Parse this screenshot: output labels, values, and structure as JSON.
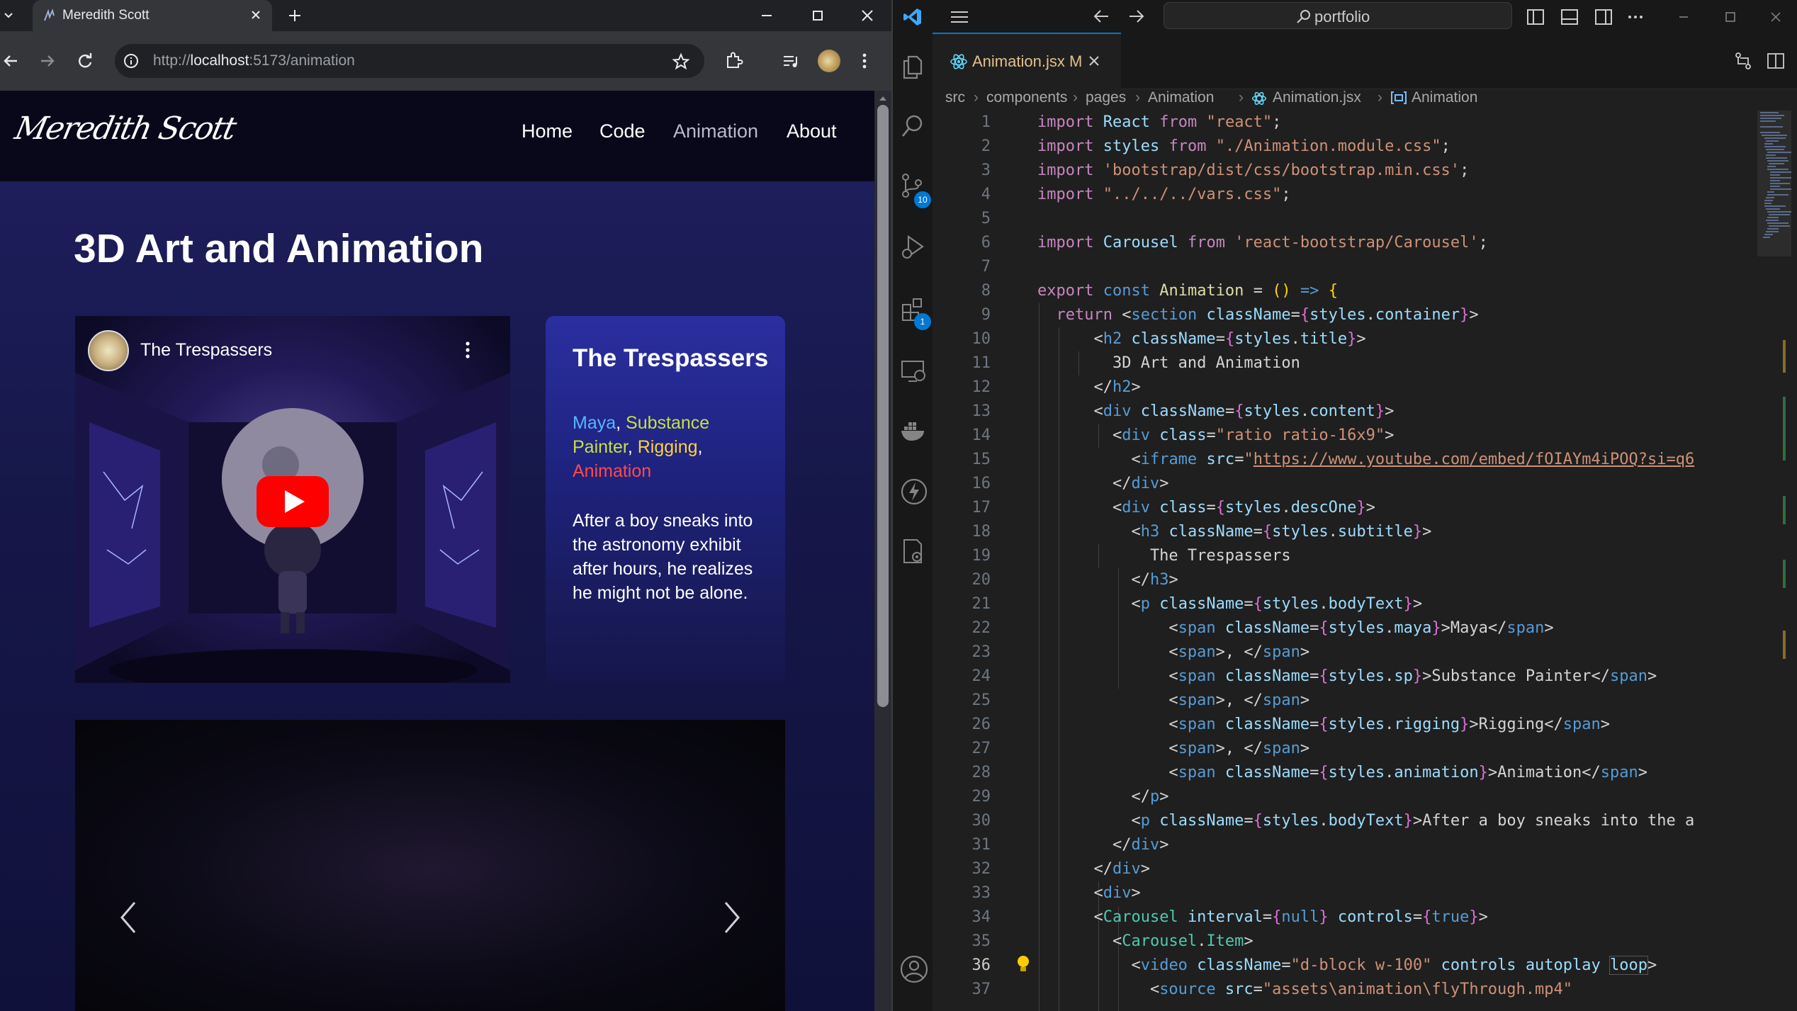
{
  "browser": {
    "tab_title": "Meredith Scott",
    "url_prefix": "http://",
    "url_host": "localhost",
    "url_path": ":5173/animation"
  },
  "site": {
    "logo": "Meredith Scott",
    "nav": {
      "home": "Home",
      "code": "Code",
      "animation": "Animation",
      "about": "About"
    },
    "page_title": "3D Art and Animation",
    "video_title": "The Trespassers",
    "card": {
      "title": "The Trespassers",
      "tags": {
        "maya": "Maya",
        "sp": "Substance Painter",
        "rigging": "Rigging",
        "animation": "Animation",
        "sep": ", "
      },
      "body": "After a boy sneaks into the astronomy exhibit after hours, he realizes he might not be alone."
    },
    "tag_colors": {
      "maya": "#58b6ff",
      "sp": "#c6e043",
      "rigging": "#ffd23a",
      "animation": "#ff4a4a"
    }
  },
  "vscode": {
    "search_text": "portfolio",
    "tab_name": "Animation.jsx",
    "tab_modified": "M",
    "source_control_badge": "10",
    "extensions_badge": "1",
    "breadcrumb": [
      "src",
      "components",
      "pages",
      "Animation",
      "Animation.jsx",
      "Animation"
    ],
    "current_line": "36"
  },
  "icons": [
    "chrome-tab-menu-icon",
    "favicon-icon",
    "close-icon",
    "plus-icon",
    "minimize-icon",
    "maximize-icon",
    "back-icon",
    "forward-icon",
    "reload-icon",
    "site-info-icon",
    "star-icon",
    "extensions-icon",
    "media-icon",
    "more-icon",
    "youtube-play-icon",
    "chevron-left-icon",
    "chevron-right-icon",
    "vscode-logo-icon",
    "hamburger-icon",
    "search-icon",
    "explorer-icon",
    "source-control-icon",
    "run-debug-icon",
    "extensions-icon",
    "remote-explorer-icon",
    "docker-icon",
    "thunder-icon",
    "settings-icon",
    "account-icon",
    "lightbulb-icon",
    "react-file-icon"
  ]
}
